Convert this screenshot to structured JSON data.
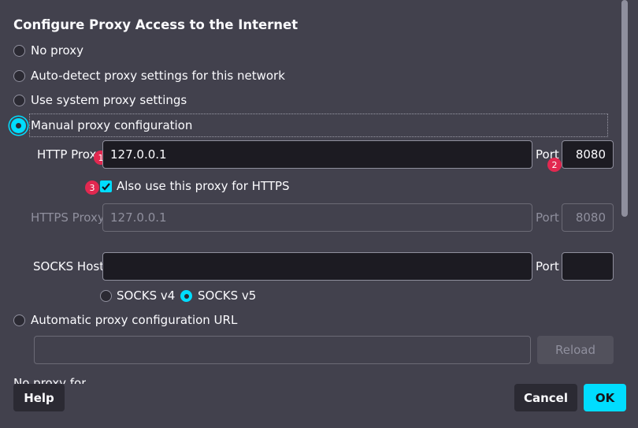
{
  "dialog": {
    "title": "Configure Proxy Access to the Internet"
  },
  "options": {
    "no_proxy": "No proxy",
    "auto_detect": "Auto-detect proxy settings for this network",
    "system": "Use system proxy settings",
    "manual": "Manual proxy configuration",
    "auto_url": "Automatic proxy configuration URL"
  },
  "http": {
    "label": "HTTP Proxy",
    "value": "127.0.0.1",
    "port_label": "Port",
    "port": "8080"
  },
  "https_checkbox": {
    "label": "Also use this proxy for HTTPS",
    "checked": true
  },
  "https": {
    "label": "HTTPS Proxy",
    "value": "127.0.0.1",
    "port_label": "Port",
    "port": "8080"
  },
  "socks": {
    "label": "SOCKS Host",
    "value": "",
    "port_label": "Port",
    "port": "",
    "v4": "SOCKS v4",
    "v5": "SOCKS v5"
  },
  "autoconfig": {
    "url": "",
    "reload": "Reload"
  },
  "truncated_label": "No proxy for",
  "badges": [
    "1",
    "2",
    "3"
  ],
  "buttons": {
    "help": "Help",
    "cancel": "Cancel",
    "ok": "OK"
  },
  "colors": {
    "background": "#42414d",
    "accent": "#00ddff",
    "badge": "#e22850",
    "field": "#1c1b22"
  }
}
